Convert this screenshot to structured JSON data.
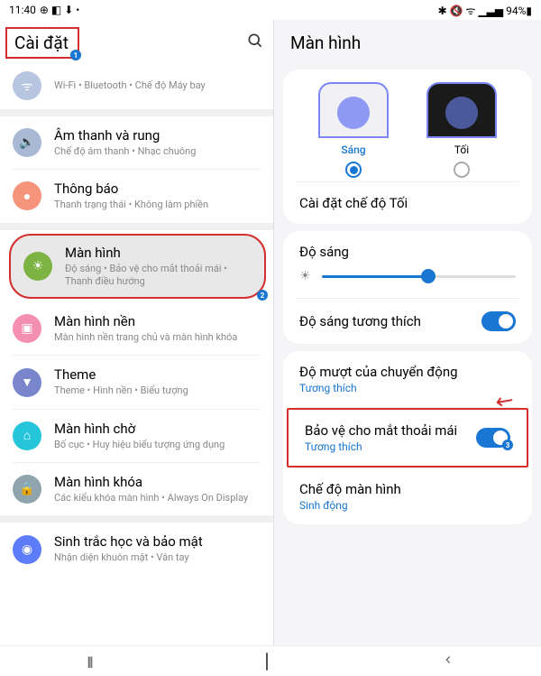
{
  "status": {
    "time": "11:40",
    "indicators": "⊕ ◧ ⬇ •",
    "right_icons": "✱ 🔇 ᯤ ▁▃▅ 94%▮"
  },
  "left": {
    "title": "Cài đặt",
    "items": [
      {
        "title": "",
        "sub": "Wi-Fi  •  Bluetooth  •  Chế độ Máy bay"
      },
      {
        "title": "Âm thanh và rung",
        "sub": "Chế độ âm thanh  •  Nhạc chuông"
      },
      {
        "title": "Thông báo",
        "sub": "Thanh trạng thái  •  Không làm phiền"
      },
      {
        "title": "Màn hình",
        "sub": "Độ sáng  •  Bảo vệ cho mắt thoải mái  •  Thanh điều hướng"
      },
      {
        "title": "Màn hình nền",
        "sub": "Màn hình nền trang chủ và màn hình khóa"
      },
      {
        "title": "Theme",
        "sub": "Theme  •  Hình nền  •  Biểu tượng"
      },
      {
        "title": "Màn hình chờ",
        "sub": "Bố cục  •  Huy hiệu biểu tượng ứng dụng"
      },
      {
        "title": "Màn hình khóa",
        "sub": "Các kiểu khóa màn hình  •  Always On Display"
      },
      {
        "title": "Sinh trắc học và bảo mật",
        "sub": "Nhận diện khuôn mặt  •  Vân tay"
      }
    ]
  },
  "right": {
    "title": "Màn hình",
    "theme_light": "Sáng",
    "theme_dark": "Tối",
    "dark_mode_settings": "Cài đặt chế độ Tối",
    "brightness_label": "Độ sáng",
    "adaptive_brightness": "Độ sáng tương thích",
    "motion_smoothness": "Độ mượt của chuyển động",
    "motion_sub": "Tương thích",
    "eye_comfort": "Bảo vệ cho mắt thoải mái",
    "eye_comfort_sub": "Tương thích",
    "screen_mode": "Chế độ màn hình",
    "screen_mode_sub": "Sinh động"
  },
  "annotations": {
    "b1": "1",
    "b2": "2",
    "b3": "3"
  }
}
